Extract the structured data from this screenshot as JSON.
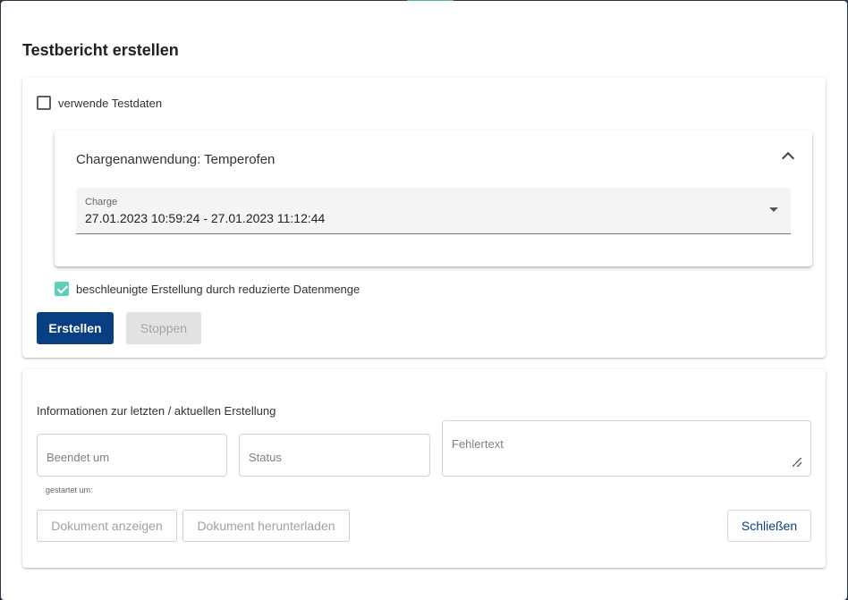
{
  "dialog": {
    "title": "Testbericht erstellen"
  },
  "options": {
    "use_testdata_label": "verwende Testdaten",
    "use_testdata_checked": false,
    "accelerated_label": "beschleunigte Erstellung durch reduzierte Datenmenge",
    "accelerated_checked": true
  },
  "panel": {
    "title": "Chargenanwendung: Temperofen",
    "expanded": true,
    "charge_select": {
      "label": "Charge",
      "value": "27.01.2023 10:59:24 - 27.01.2023 11:12:44"
    }
  },
  "actions": {
    "create_label": "Erstellen",
    "stop_label": "Stoppen"
  },
  "info": {
    "heading": "Informationen zur letzten / aktuellen Erstellung",
    "finished_placeholder": "Beendet um",
    "status_placeholder": "Status",
    "error_placeholder": "Fehlertext",
    "started_hint": "gestartet um:"
  },
  "footer": {
    "show_document_label": "Dokument anzeigen",
    "download_document_label": "Dokument herunterladen",
    "close_label": "Schließen"
  },
  "colors": {
    "primary": "#073f82",
    "checkbox_accent": "#5cd0bb",
    "disabled_bg": "#e2e2e2"
  }
}
